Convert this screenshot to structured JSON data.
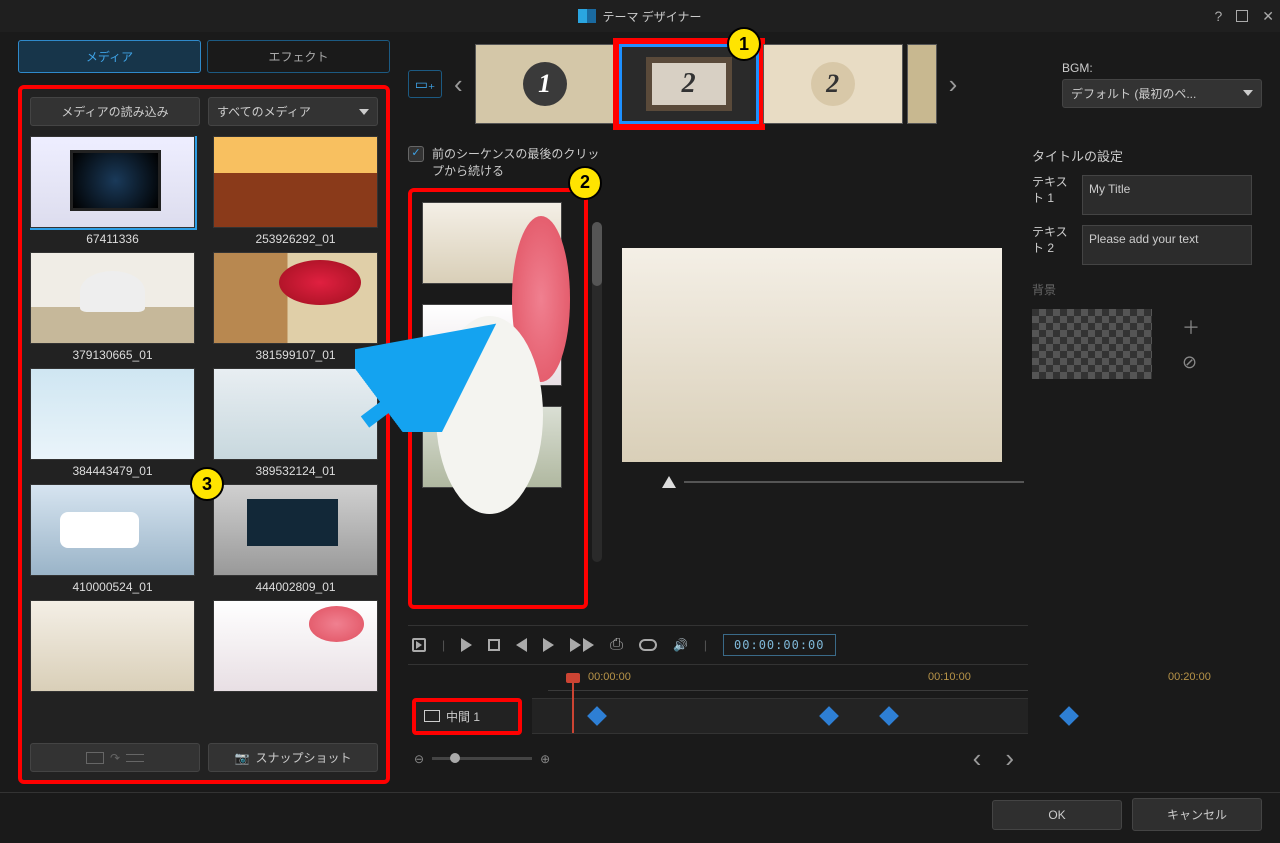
{
  "title": "テーマ デザイナー",
  "tabs": {
    "media": "メディア",
    "effects": "エフェクト"
  },
  "mediaTop": {
    "import": "メディアの読み込み",
    "filter": "すべてのメディア"
  },
  "mediaItems": [
    {
      "label": "67411336"
    },
    {
      "label": "253926292_01"
    },
    {
      "label": "379130665_01"
    },
    {
      "label": "381599107_01"
    },
    {
      "label": "384443479_01"
    },
    {
      "label": "389532124_01"
    },
    {
      "label": "410000524_01"
    },
    {
      "label": "444002809_01"
    }
  ],
  "snapshot": "スナップショット",
  "bgm": {
    "label": "BGM:",
    "value": "デフォルト (最初のペ..."
  },
  "continueCheck": "前のシーケンスの最後のクリップから続ける",
  "titleSettings": {
    "header": "タイトルの設定",
    "text1label": "テキスト 1",
    "text1value": "My Title",
    "text2label": "テキスト 2",
    "text2value": "Please add your text",
    "bglabel": "背景"
  },
  "timecode": "00:00:00:00",
  "ruler": {
    "t0": "00:00:00",
    "t1": "00:10:00",
    "t2": "00:20:00"
  },
  "trackLabel": "中間 1",
  "footer": {
    "ok": "OK",
    "cancel": "キャンセル"
  },
  "badges": {
    "b1": "1",
    "b2": "2",
    "b3": "3"
  }
}
